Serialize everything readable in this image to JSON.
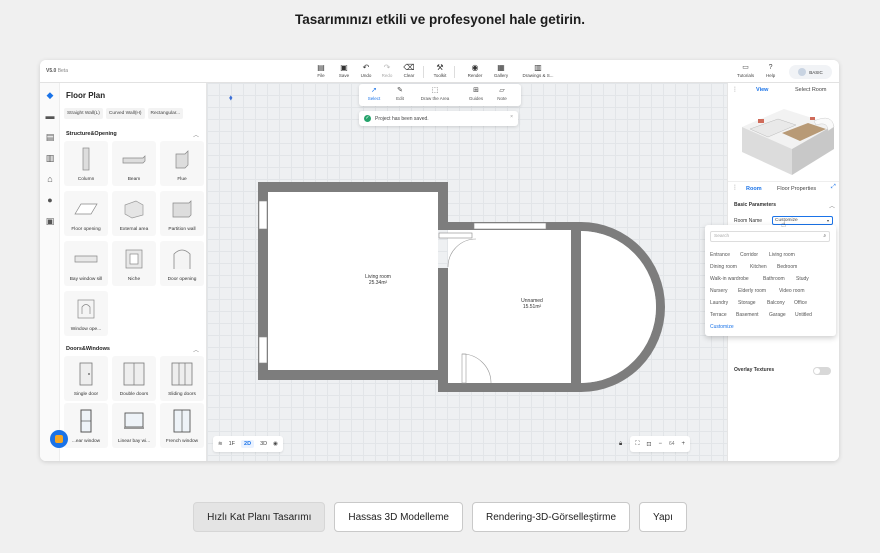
{
  "headline": "Tasarımınızı etkili ve profesyonel hale getirin.",
  "app": {
    "version_label": "V5.0",
    "version_badge": "Beta",
    "toolbar": [
      {
        "label": "File",
        "icon": "file-icon"
      },
      {
        "label": "Save",
        "icon": "save-icon"
      },
      {
        "label": "Undo",
        "icon": "undo-icon"
      },
      {
        "label": "Redo",
        "icon": "redo-icon"
      },
      {
        "label": "Clear",
        "icon": "clear-icon"
      },
      {
        "label": "Toolkit",
        "icon": "toolkit-icon"
      },
      {
        "label": "Render",
        "icon": "render-icon"
      },
      {
        "label": "Gallery",
        "icon": "gallery-icon"
      },
      {
        "label": "Drawings & S...",
        "icon": "drawings-icon"
      }
    ],
    "right_toolbar": [
      {
        "label": "Tutorials",
        "icon": "tutorials-icon"
      },
      {
        "label": "Help",
        "icon": "help-icon"
      }
    ],
    "user_badge": "BASIC"
  },
  "left_panel": {
    "title": "Floor Plan",
    "wall_tabs": [
      "Straight Wall(L)",
      "Curved Wall(H)",
      "Rectangular..."
    ],
    "section_structure": "Structure&Opening",
    "structure_items": [
      "Column",
      "Beam",
      "Flue",
      "Floor opening",
      "External area",
      "Partition wall",
      "Bay window sill",
      "Niche",
      "Door opening",
      "Window ope..."
    ],
    "section_doors": "Doors&Windows",
    "door_items": [
      "Single door",
      "Double doors",
      "Sliding doors",
      "...ear window",
      "Linear bay wi...",
      "French window"
    ]
  },
  "canvas": {
    "tools": [
      {
        "label": "Select",
        "icon": "select-icon"
      },
      {
        "label": "Edit",
        "icon": "edit-icon"
      },
      {
        "label": "Draw the Area",
        "icon": "draw-area-icon"
      },
      {
        "label": "Guides",
        "icon": "guides-icon"
      },
      {
        "label": "Note",
        "icon": "note-icon"
      }
    ],
    "toast": "Project has been saved.",
    "rooms": [
      {
        "name": "Living room",
        "area": "25.34m²"
      },
      {
        "name": "Unnamed",
        "area": "15.51m²"
      }
    ],
    "floor_count": "1F",
    "view_2d": "2D",
    "view_3d": "3D",
    "zoom_value": "64"
  },
  "right_panel": {
    "tabs": [
      "View",
      "Select Room"
    ],
    "room_tabs": [
      "Room",
      "Floor Properties"
    ],
    "basic_parameters": "Basic Parameters",
    "room_name_label": "Room Name",
    "room_name_value": "Customize",
    "search_placeholder": "Search",
    "room_options": [
      [
        "Entrance",
        "Corridor",
        "Living room"
      ],
      [
        "Dining room",
        "Kitchen",
        "Bedroom"
      ],
      [
        "Walk-in wardrobe",
        "Bathroom",
        "Study"
      ],
      [
        "Nursery",
        "Elderly room",
        "Video room"
      ],
      [
        "Laundry",
        "Storage",
        "Balcony",
        "Office"
      ],
      [
        "Terrace",
        "Basement",
        "Garage",
        "Untitled"
      ],
      [
        "Customize"
      ]
    ],
    "overlay_textures": "Overlay Textures"
  },
  "bottom_buttons": [
    "Hızlı Kat Planı Tasarımı",
    "Hassas 3D Modelleme",
    "Rendering-3D-Görselleştirme",
    "Yapı"
  ]
}
